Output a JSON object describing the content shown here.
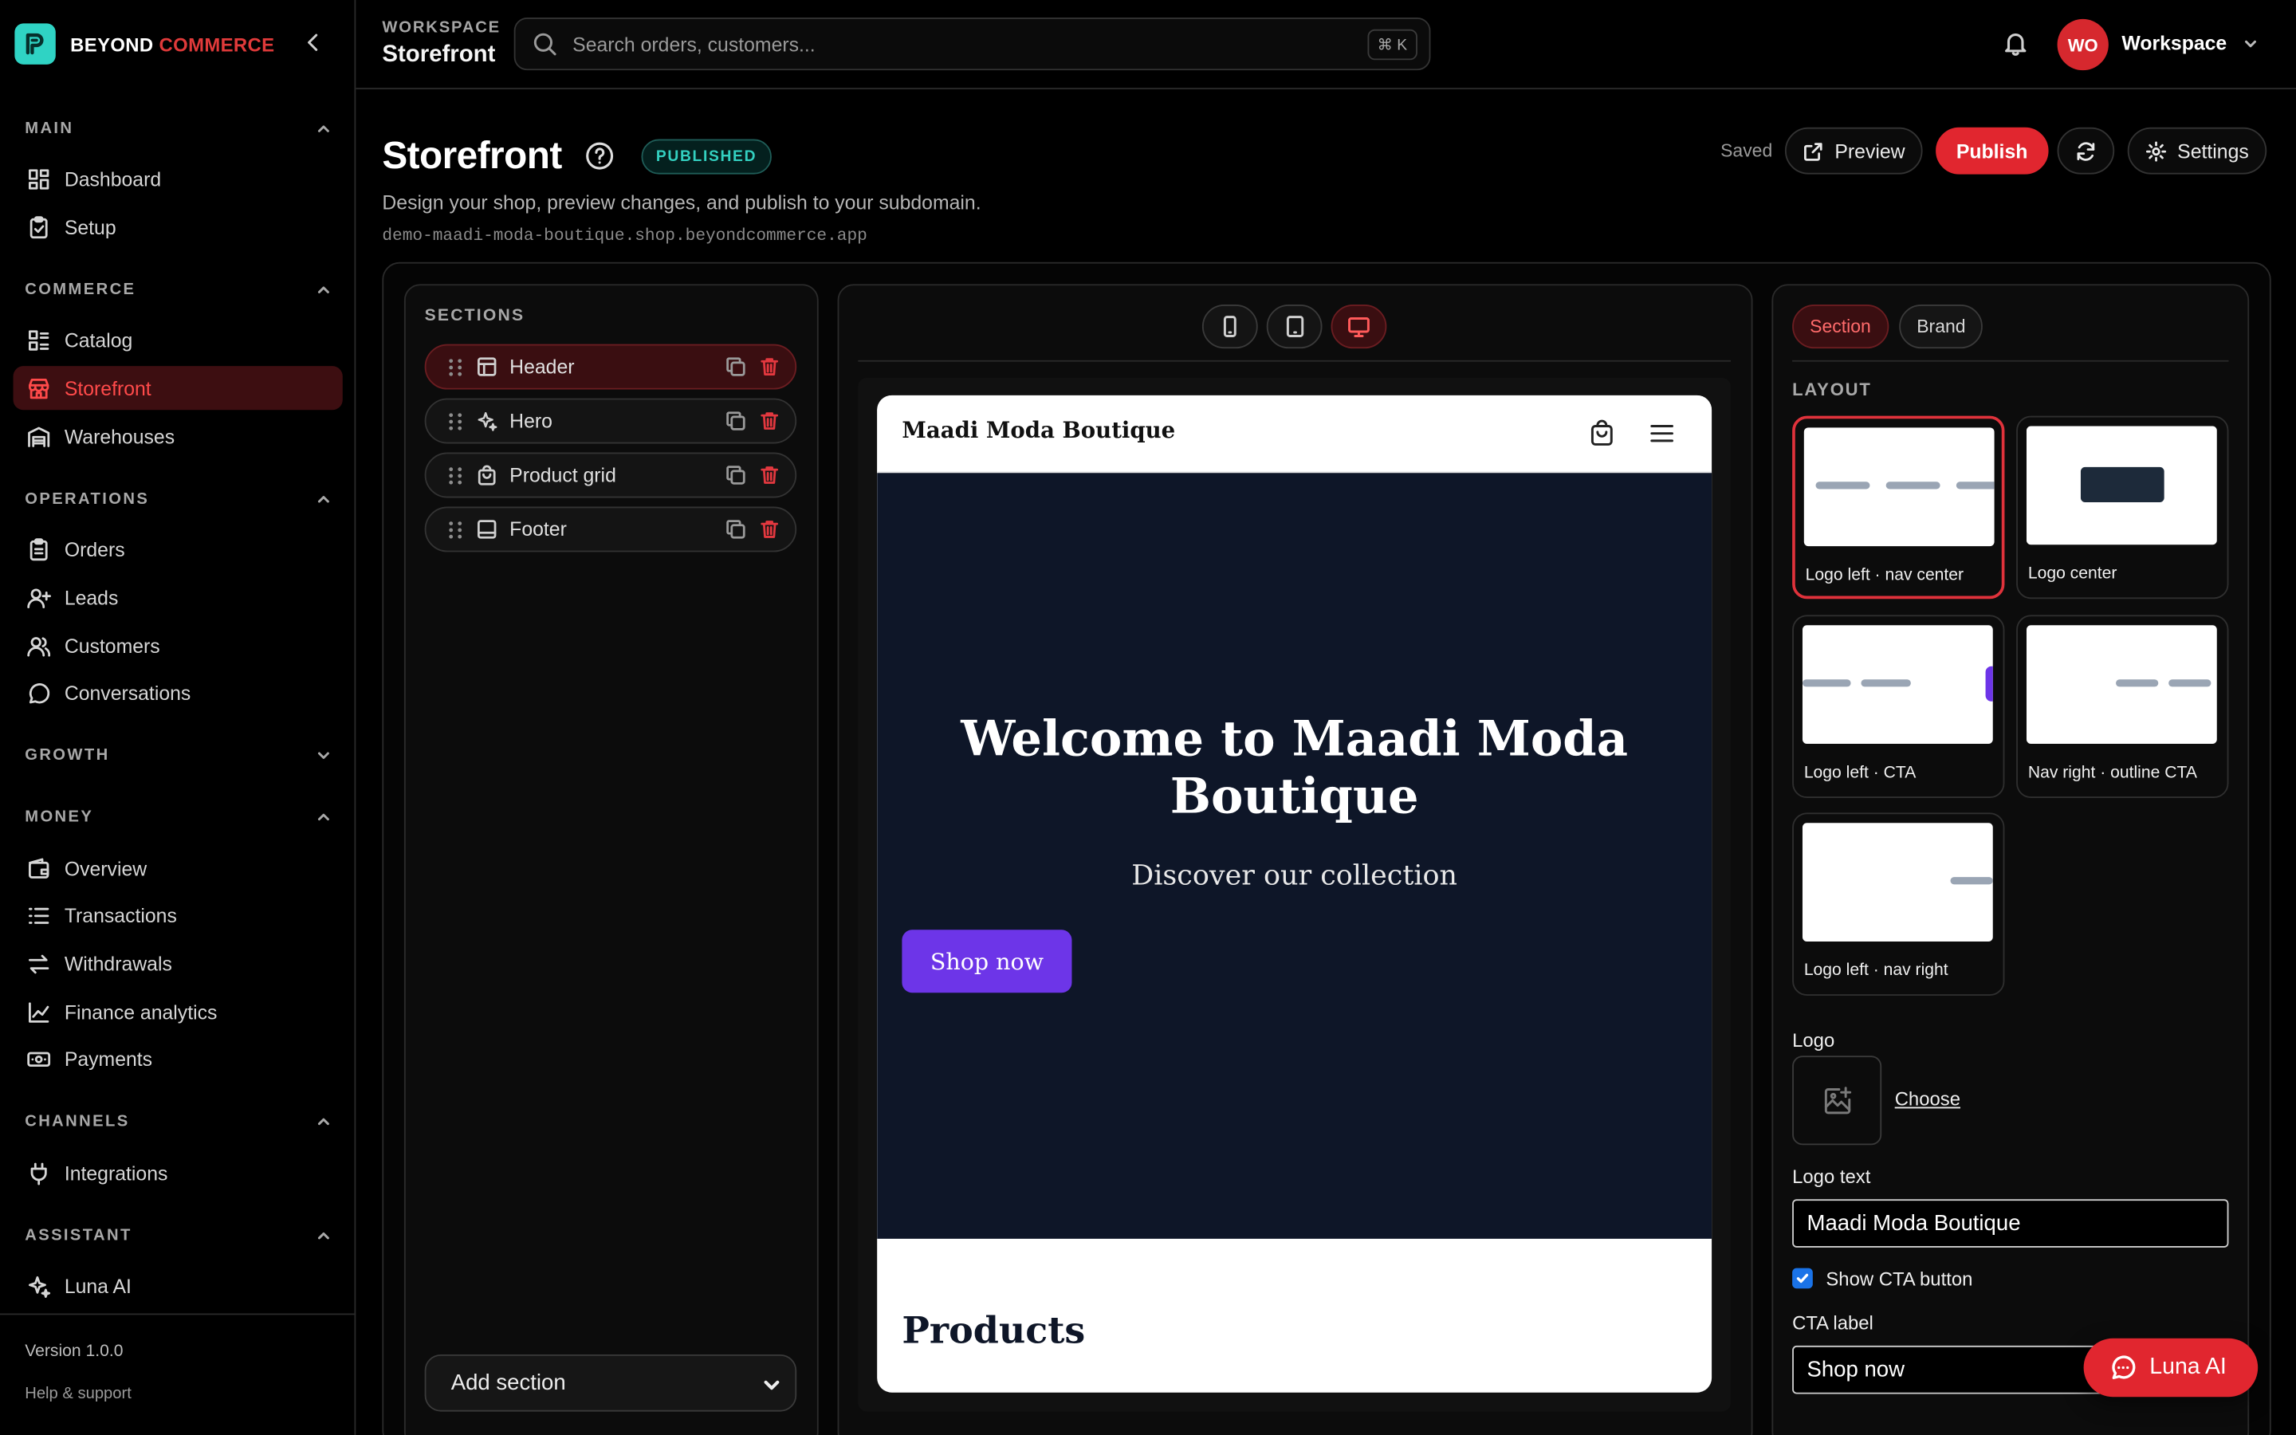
{
  "brand": {
    "part1": "BEYOND",
    "part2": "COMMERCE",
    "accent": "#e03a3a",
    "logo_color": "#2fd3c4"
  },
  "sidebar": {
    "groups": [
      {
        "label": "MAIN",
        "items": [
          {
            "label": "Dashboard",
            "icon": "dashboard-icon"
          },
          {
            "label": "Setup",
            "icon": "clipboard-check-icon"
          }
        ]
      },
      {
        "label": "COMMERCE",
        "items": [
          {
            "label": "Catalog",
            "icon": "catalog-icon"
          },
          {
            "label": "Storefront",
            "icon": "store-icon",
            "active": true
          },
          {
            "label": "Warehouses",
            "icon": "warehouse-icon"
          }
        ]
      },
      {
        "label": "OPERATIONS",
        "items": [
          {
            "label": "Orders",
            "icon": "clipboard-list-icon"
          },
          {
            "label": "Leads",
            "icon": "user-plus-icon"
          },
          {
            "label": "Customers",
            "icon": "users-icon"
          },
          {
            "label": "Conversations",
            "icon": "chat-icon"
          }
        ]
      },
      {
        "label": "GROWTH",
        "items": []
      },
      {
        "label": "MONEY",
        "items": [
          {
            "label": "Overview",
            "icon": "wallet-icon"
          },
          {
            "label": "Transactions",
            "icon": "list-icon"
          },
          {
            "label": "Withdrawals",
            "icon": "arrows-exchange-icon"
          },
          {
            "label": "Finance analytics",
            "icon": "line-chart-icon"
          },
          {
            "label": "Payments",
            "icon": "banknote-icon"
          }
        ]
      },
      {
        "label": "CHANNELS",
        "items": [
          {
            "label": "Integrations",
            "icon": "plug-icon"
          }
        ]
      },
      {
        "label": "ASSISTANT",
        "items": [
          {
            "label": "Luna AI",
            "icon": "sparkles-icon"
          }
        ]
      }
    ],
    "version": "Version 1.0.0",
    "help": "Help & support"
  },
  "topbar": {
    "workspace_label": "WORKSPACE",
    "workspace_name": "Storefront",
    "search_placeholder": "Search orders, customers...",
    "shortcut": "⌘ K",
    "avatar_initials": "WO",
    "workspace_menu": "Workspace"
  },
  "page": {
    "title": "Storefront",
    "status": "PUBLISHED",
    "description": "Design your shop, preview changes, and publish to your subdomain.",
    "subdomain": "demo-maadi-moda-boutique.shop.beyondcommerce.app",
    "saved": "Saved",
    "preview": "Preview",
    "publish": "Publish",
    "settings": "Settings"
  },
  "sections": {
    "title": "SECTIONS",
    "items": [
      {
        "label": "Header",
        "icon": "layout-icon",
        "active": true
      },
      {
        "label": "Hero",
        "icon": "sparkles-icon"
      },
      {
        "label": "Product grid",
        "icon": "shopping-bag-icon"
      },
      {
        "label": "Footer",
        "icon": "footer-icon"
      }
    ],
    "add_section": "Add section"
  },
  "preview": {
    "devices": [
      "mobile",
      "tablet",
      "desktop"
    ],
    "active_device": "desktop",
    "logo_text": "Maadi Moda Boutique",
    "hero_heading": "Welcome to Maadi Moda Boutique",
    "hero_subheading": "Discover our collection",
    "hero_cta": "Shop now",
    "products_heading": "Products",
    "hero_bg": "#0e1628",
    "cta_color": "#6d35e8"
  },
  "inspector": {
    "tabs": [
      "Section",
      "Brand"
    ],
    "active_tab": "Section",
    "layout_label": "LAYOUT",
    "layouts": [
      "Logo left · nav center",
      "Logo center",
      "Logo left · CTA",
      "Nav right · outline CTA",
      "Logo left · nav right"
    ],
    "active_layout": "Logo left · nav center",
    "logo_label": "Logo",
    "choose": "Choose",
    "logo_text_label": "Logo text",
    "logo_text_value": "Maadi Moda Boutique",
    "show_cta_label": "Show CTA button",
    "show_cta": true,
    "cta_label_label": "CTA label",
    "cta_label_value": "Shop now"
  },
  "luna": {
    "label": "Luna AI"
  }
}
